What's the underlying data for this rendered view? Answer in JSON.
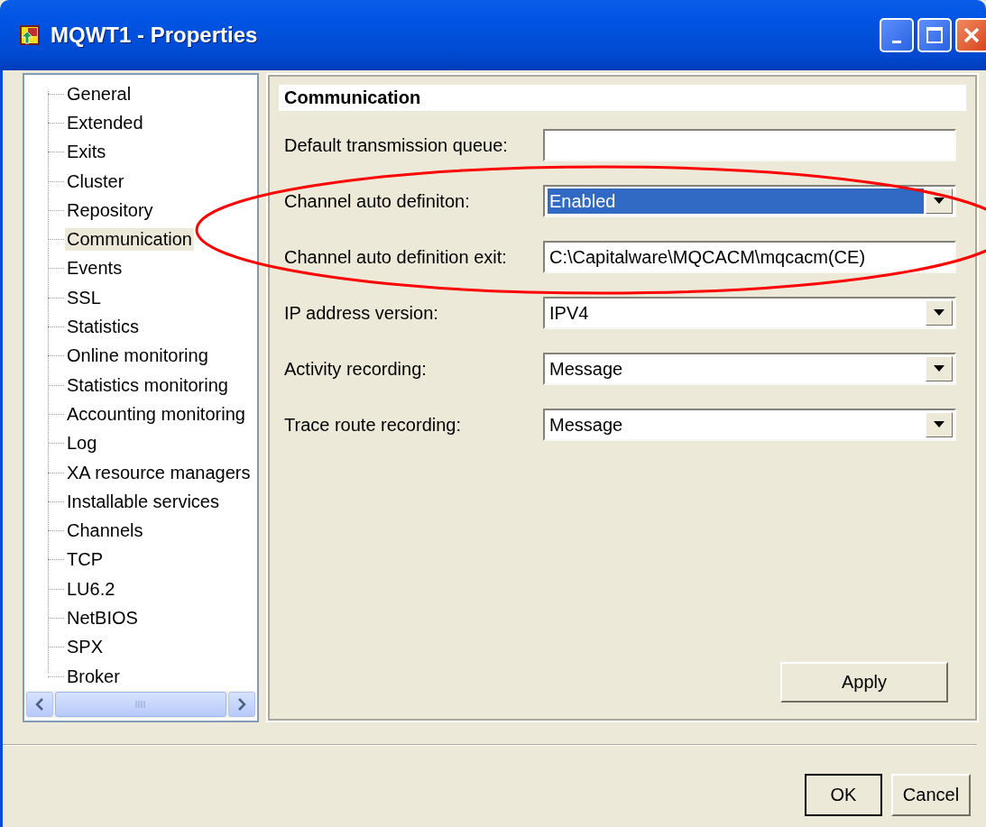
{
  "window": {
    "title": "MQWT1 - Properties"
  },
  "tree": {
    "items": [
      {
        "label": "General",
        "selected": false
      },
      {
        "label": "Extended",
        "selected": false
      },
      {
        "label": "Exits",
        "selected": false
      },
      {
        "label": "Cluster",
        "selected": false
      },
      {
        "label": "Repository",
        "selected": false
      },
      {
        "label": "Communication",
        "selected": true
      },
      {
        "label": "Events",
        "selected": false
      },
      {
        "label": "SSL",
        "selected": false
      },
      {
        "label": "Statistics",
        "selected": false
      },
      {
        "label": "Online monitoring",
        "selected": false
      },
      {
        "label": "Statistics monitoring",
        "selected": false
      },
      {
        "label": "Accounting monitoring",
        "selected": false
      },
      {
        "label": "Log",
        "selected": false
      },
      {
        "label": "XA resource managers",
        "selected": false
      },
      {
        "label": "Installable services",
        "selected": false
      },
      {
        "label": "Channels",
        "selected": false
      },
      {
        "label": "TCP",
        "selected": false
      },
      {
        "label": "LU6.2",
        "selected": false
      },
      {
        "label": "NetBIOS",
        "selected": false
      },
      {
        "label": "SPX",
        "selected": false
      },
      {
        "label": "Broker",
        "selected": false
      }
    ]
  },
  "page": {
    "heading": "Communication",
    "fields": [
      {
        "label": "Default transmission queue:",
        "kind": "text",
        "focused": false
      },
      {
        "label": "Channel auto definiton:",
        "kind": "combo",
        "value": "Enabled",
        "focused": true
      },
      {
        "label": "Channel auto definition exit:",
        "kind": "text",
        "value": "C:\\Capitalware\\MQCACM\\mqcacm(CE)",
        "focused": false
      },
      {
        "label": "IP address version:",
        "kind": "combo",
        "value": "IPV4",
        "focused": false
      },
      {
        "label": "Activity recording:",
        "kind": "combo",
        "value": "Message",
        "focused": false
      },
      {
        "label": "Trace route recording:",
        "kind": "combo",
        "value": "Message",
        "focused": false
      }
    ],
    "apply_button": "Apply"
  },
  "buttons": [
    "OK",
    "Cancel"
  ]
}
